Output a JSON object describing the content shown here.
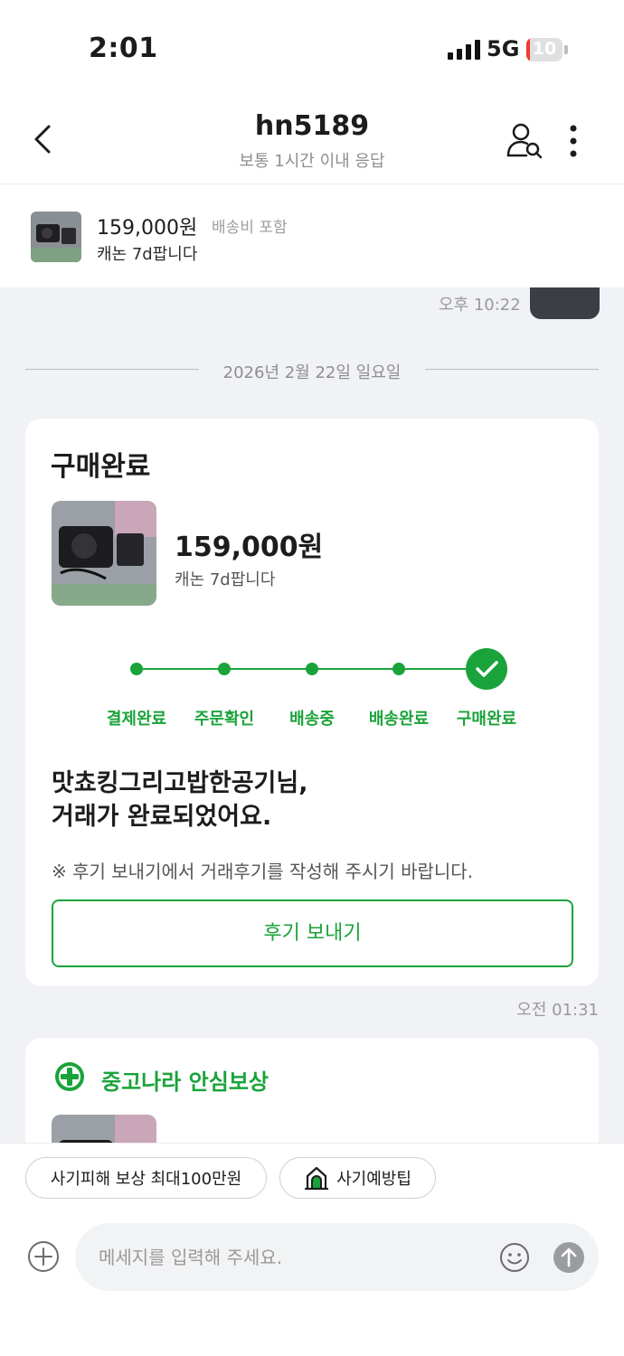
{
  "status": {
    "time": "2:01",
    "network": "5G",
    "battery": "10",
    "battery_level": 0.1
  },
  "header": {
    "title": "hn5189",
    "subtitle": "보통 1시간 이내 응답",
    "icons": {
      "back": "back-chevron-icon",
      "user": "user-search-icon",
      "more": "more-vertical-icon"
    }
  },
  "product": {
    "price": "159,000원",
    "shipping": "배송비 포함",
    "name": "캐논 7d팝니다"
  },
  "chat": {
    "prev_time": "오후 10:22",
    "date": "2026년 2월 22일 일요일",
    "purchase_card": {
      "title": "구매완료",
      "price": "159,000원",
      "name": "캐논 7d팝니다",
      "steps": [
        "결제완료",
        "주문확인",
        "배송중",
        "배송완료",
        "구매완료"
      ],
      "current_step": 5,
      "message_line1": "맛쵸킹그리고밥한공기님,",
      "message_line2": "거래가 완료되었어요.",
      "note": "※ 후기 보내기에서 거래후기를 작성해 주시기 바랍니다.",
      "review_button": "후기 보내기",
      "accent_color": "#1aa33a"
    },
    "message_time": "오전 01:31",
    "safe_card": {
      "title": "중고나라 안심보상",
      "icon": "plus-shield-icon"
    }
  },
  "bottom": {
    "chip_compensation": "사기피해 보상 최대100만원",
    "chip_tips": "사기예방팁",
    "input_placeholder": "메세지를 입력해 주세요.",
    "icons": {
      "add": "plus-circle-icon",
      "emoji": "emoji-icon",
      "send": "send-arrow-icon",
      "tips": "lock-house-icon"
    }
  }
}
